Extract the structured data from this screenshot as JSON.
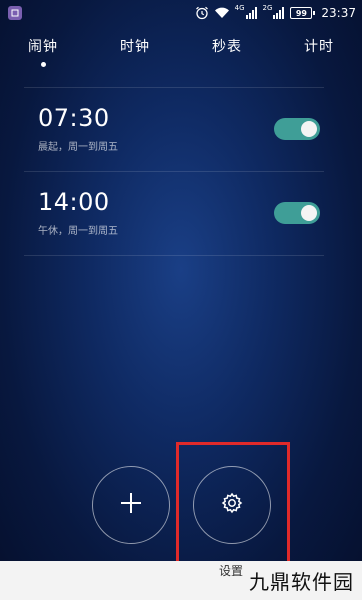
{
  "status_bar": {
    "net_a": "4G",
    "net_b": "2G",
    "battery": "99",
    "time": "23:37"
  },
  "tabs": [
    {
      "label": "闹钟",
      "active": true
    },
    {
      "label": "时钟",
      "active": false
    },
    {
      "label": "秒表",
      "active": false
    },
    {
      "label": "计时",
      "active": false
    }
  ],
  "alarms": [
    {
      "time": "07:30",
      "description": "晨起，周一到周五",
      "enabled": true
    },
    {
      "time": "14:00",
      "description": "午休，周一到周五",
      "enabled": true
    }
  ],
  "actions": {
    "new_label": "新建",
    "settings_label": "设置"
  },
  "watermark": "九鼎软件园",
  "colors": {
    "toggle_on": "#3f9e97",
    "highlight": "#e02a2a"
  }
}
